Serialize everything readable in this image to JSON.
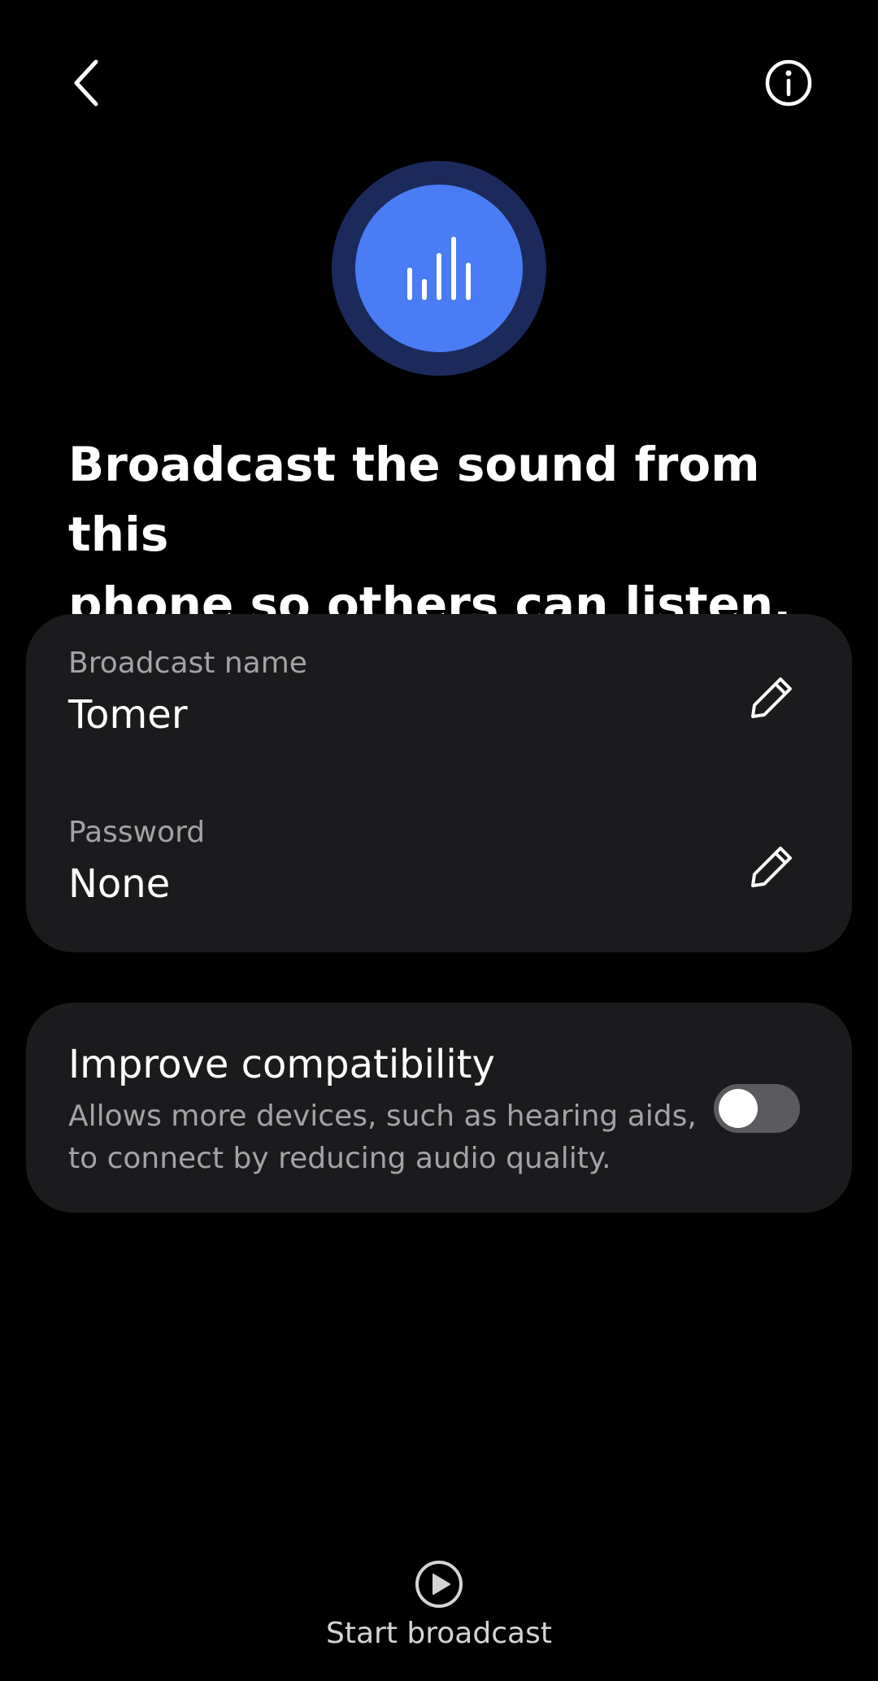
{
  "header": {
    "back_icon": "chevron-left-icon",
    "info_icon": "info-icon"
  },
  "hero": {
    "icon": "audio-bars-icon",
    "outer_color": "#1b2a5a",
    "inner_color": "#4a7cf5"
  },
  "headline": {
    "line1": "Broadcast the sound from this",
    "line2": "phone so others can listen."
  },
  "settings": {
    "broadcast_name_label": "Broadcast name",
    "broadcast_name_value": "Tomer",
    "password_label": "Password",
    "password_value": "None",
    "edit_icon": "pencil-icon"
  },
  "compatibility": {
    "title": "Improve compatibility",
    "description": "Allows more devices, such as hearing aids, to connect by reducing audio quality.",
    "toggle_on": false
  },
  "footer": {
    "start_label": "Start broadcast",
    "start_icon": "play-circle-icon"
  },
  "colors": {
    "background": "#000000",
    "card": "#1b1b1d",
    "secondary_text": "#a3a3a6"
  }
}
